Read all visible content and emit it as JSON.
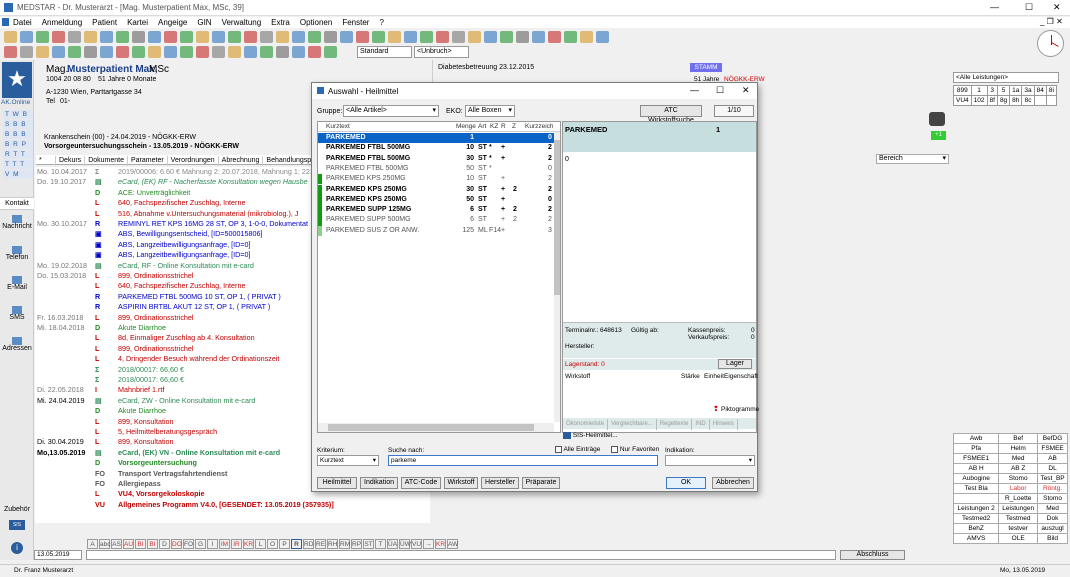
{
  "window": {
    "title": "MEDSTAR - Dr. Musterarzt - [Mag. Musterpatient Max, MSc, 39]",
    "min": "—",
    "max": "☐",
    "close": "✕"
  },
  "menu": [
    "Datei",
    "Anmeldung",
    "Patient",
    "Kartei",
    "Angeige",
    "GIN",
    "Verwaltung",
    "Extra",
    "Optionen",
    "Fenster",
    "?"
  ],
  "toolbar": {
    "standard": "Standard",
    "unbruch": "<Unbruch>"
  },
  "patient": {
    "title": "Mag.",
    "name": "Musterpatient Max,",
    "suffix": "MSc",
    "svnr": "1004 20 08 80",
    "age": "51 Jahre 0 Monate",
    "address": "A-1230 Wien, Parttartgasse 34",
    "tel_label": "Tel",
    "tel": "01-",
    "logo_text": "AK.Online",
    "info": "Diabetesbetreuung 23.12.2015",
    "stamm": "STAMM",
    "stamm_age": "51 Jahre",
    "stamm_ins": "NÖGKK-ERW"
  },
  "krankenschein": "Krankenschein (00) - 24.04.2019 - NÖGKK-ERW",
  "vorsorge": "Vorsorgeuntersuchungsschein - 13.05.2019 - NÖGKK-ERW",
  "tabs": [
    "*",
    "Dekurs",
    "Dokumente",
    "Parameter",
    "Verordnungen",
    "Abrechnung",
    "Behandlungsperioden"
  ],
  "bereich": "Bereich",
  "left_letters": [
    "T W B",
    "S B B",
    "B B B",
    "B R P",
    "R T T",
    "T T T",
    "V M"
  ],
  "side_nav": {
    "kontakt": "Kontakt",
    "nachricht": "Nachricht",
    "telefon": "Telefon",
    "email": "E-Mail",
    "sms": "SMS",
    "adressen": "Adressen",
    "zubehoer": "Zubehör",
    "sis": "SIS"
  },
  "records": [
    {
      "d": "Mo. 10.04.2017",
      "t": "Σ",
      "txt": "2019/00006: 6.60 € Mahnung 2: 20.07.2018, Mahnung 1: 22.0",
      "c": "#888"
    },
    {
      "d": "Do. 19.10.2017",
      "t": "▤",
      "txt": "eCard, (EK) RF - Nacherfasste Konsultation wegen Hausbe",
      "c": "#2e8b57",
      "i": true
    },
    {
      "d": "",
      "t": "D",
      "txt": "ACE: Unverträglichkeit",
      "c": "#228b22"
    },
    {
      "d": "",
      "t": "L",
      "txt": "640, Fachspezifischer Zuschlag, Interne",
      "c": "#c00000"
    },
    {
      "d": "",
      "t": "L",
      "txt": "516, Abnahme v.Untersuchungsmaterial (mikrobiolog.), J",
      "c": "#c00000"
    },
    {
      "d": "Mo. 30.10.2017",
      "t": "R",
      "txt": "REMINYL RET KPS 16MG 28 ST, OP 3, 1-0-0, Dokumentat",
      "c": "#0000cc"
    },
    {
      "d": "",
      "t": "▣",
      "txt": "ABS, Bewilligungsentscheid, [ID=500015806]",
      "c": "#0000cc"
    },
    {
      "d": "",
      "t": "▣",
      "txt": "ABS, Langzeitbewilligungsanfrage, [ID=0]",
      "c": "#0000cc"
    },
    {
      "d": "",
      "t": "▣",
      "txt": "ABS, Langzeitbewilligungsanfrage, [ID=0]",
      "c": "#0000cc"
    },
    {
      "d": "Mo. 19.02.2018",
      "t": "▤",
      "txt": "eCard, RF - Online Konsultation mit e-card",
      "c": "#2e8b57"
    },
    {
      "d": "Do. 15.03.2018",
      "t": "L",
      "txt": "899, Ordinationsstrichel",
      "c": "#c00000"
    },
    {
      "d": "",
      "t": "L",
      "txt": "640, Fachspezifischer Zuschlag, Interne",
      "c": "#c00000"
    },
    {
      "d": "",
      "t": "R",
      "txt": "PARKEMED FTBL 500MG 10 ST, OP 1, ( PRIVAT )",
      "c": "#0000cc"
    },
    {
      "d": "",
      "t": "R",
      "txt": "ASPIRIN BRTBL AKUT 12 ST, OP 1, ( PRIVAT )",
      "c": "#0000cc"
    },
    {
      "d": "Fr. 16.03.2018",
      "t": "L",
      "txt": "899, Ordinationsstrichel",
      "c": "#c00000"
    },
    {
      "d": "Mi. 18.04.2018",
      "t": "D",
      "txt": "Akute Diarrhoe",
      "c": "#228b22"
    },
    {
      "d": "",
      "t": "L",
      "txt": "8d, Einmaliger Zuschlag ab 4. Konsultation",
      "c": "#c00000"
    },
    {
      "d": "",
      "t": "L",
      "txt": "899, Ordinationsstrichel",
      "c": "#c00000"
    },
    {
      "d": "",
      "t": "L",
      "txt": "4, Dringender Besuch während der Ordinationszeit",
      "c": "#c00000"
    },
    {
      "d": "",
      "t": "Σ",
      "txt": "2018/00017: 66,60 €",
      "c": "#2e8b57"
    },
    {
      "d": "",
      "t": "Σ",
      "txt": "2018/00017: 66,60 €",
      "c": "#2e8b57"
    },
    {
      "d": "Di. 22.05.2018",
      "t": "I",
      "txt": "Mahnbrief 1.rtf",
      "c": "#c00000"
    },
    {
      "d": "Mi. 24.04.2019",
      "t": "▤",
      "txt": "eCard, ZW - Online Konsultation mit e-card",
      "c": "#2e8b57",
      "dd": "#000"
    },
    {
      "d": "",
      "t": "D",
      "txt": "Akute Diarrhoe",
      "c": "#228b22"
    },
    {
      "d": "",
      "t": "L",
      "txt": "899, Konsultation",
      "c": "#c00000"
    },
    {
      "d": "",
      "t": "L",
      "txt": "5, Heilmittelberatungsgespräch",
      "c": "#c00000"
    },
    {
      "d": "Di. 30.04.2019",
      "t": "L",
      "txt": "899, Konsultation",
      "c": "#c00000",
      "dd": "#000"
    },
    {
      "d": "Mo,13.05.2019",
      "t": "▤",
      "txt": "eCard, (EK) VN - Online Konsultation mit e-card",
      "c": "#2e8b57",
      "b": true,
      "dd": "#000"
    },
    {
      "d": "",
      "t": "D",
      "txt": "Vorsorgeuntersuchung",
      "c": "#228b22",
      "b": true
    },
    {
      "d": "",
      "t": "FO",
      "txt": "Transport Vertragsfahrtendienst",
      "c": "#555",
      "b": true
    },
    {
      "d": "",
      "t": "FO",
      "txt": "Allergiepass",
      "c": "#555",
      "b": true
    },
    {
      "d": "",
      "t": "L",
      "txt": "VU4, Vorsorgekoloskopie",
      "c": "#c00000",
      "b": true
    },
    {
      "d": "",
      "t": "VU",
      "txt": "Allgemeines Programm V4.0, [GESENDET: 13.05.2019 (357935)]",
      "c": "#c00000",
      "b": true
    }
  ],
  "dialog": {
    "title": "Auswahl - Heilmittel",
    "gruppe_label": "Gruppe:",
    "gruppe": "<Alle Artikel>",
    "eko_label": "EKO:",
    "eko": "Alle Boxen",
    "atc_btn": "ATC Wirkstoffsuche",
    "page": "1/10",
    "cols": {
      "kurztext": "Kurztext",
      "menge": "Menge",
      "art": "Art",
      "kz": "KZ",
      "r": "R",
      "z": "Z",
      "kurzzeich": "Kurzzeich"
    },
    "items": [
      {
        "n": "PARKEMED",
        "m": "1",
        "a": "",
        "k": "",
        "r": "",
        "z": "",
        "e": "0",
        "sel": true,
        "bold": true,
        "bar": "#0a63c7"
      },
      {
        "n": "PARKEMED FTBL 500MG",
        "m": "10",
        "a": "ST",
        "k": "*",
        "r": "+",
        "z": "",
        "e": "2",
        "bold": true,
        "bar": ""
      },
      {
        "n": "PARKEMED FTBL 500MG",
        "m": "30",
        "a": "ST",
        "k": "*",
        "r": "+",
        "z": "",
        "e": "2",
        "bold": true,
        "bar": ""
      },
      {
        "n": "PARKEMED FTBL 500MG",
        "m": "50",
        "a": "ST",
        "k": "*",
        "r": "",
        "z": "",
        "e": "0",
        "bold": false,
        "bar": ""
      },
      {
        "n": "PARKEMED KPS 250MG",
        "m": "10",
        "a": "ST",
        "k": "",
        "r": "+",
        "z": "",
        "e": "2",
        "bold": false,
        "bar": "#119c11"
      },
      {
        "n": "PARKEMED KPS 250MG",
        "m": "30",
        "a": "ST",
        "k": "",
        "r": "+",
        "z": "2",
        "e": "2",
        "bold": true,
        "bar": "#119c11"
      },
      {
        "n": "PARKEMED KPS 250MG",
        "m": "50",
        "a": "ST",
        "k": "",
        "r": "+",
        "z": "",
        "e": "0",
        "bold": true,
        "bar": "#119c11"
      },
      {
        "n": "PARKEMED SUPP 125MG",
        "m": "6",
        "a": "ST",
        "k": "",
        "r": "+",
        "z": "2",
        "e": "2",
        "bold": true,
        "bar": "#119c11"
      },
      {
        "n": "PARKEMED SUPP 500MG",
        "m": "6",
        "a": "ST",
        "k": "",
        "r": "+",
        "z": "2",
        "e": "2",
        "bold": false,
        "bar": "#119c11"
      },
      {
        "n": "PARKEMED SUS Z OR ANW.",
        "m": "125",
        "a": "ML",
        "k": "F14",
        "r": "+",
        "z": "",
        "e": "3",
        "bold": false,
        "bar": "#8ecf8e"
      }
    ],
    "detail_name": "PARKEMED",
    "detail_qty": "1",
    "detail_zero": "0",
    "terminalnr_label": "Terminalnr.:",
    "terminalnr": "648613",
    "gueltig": "Gültig ab:",
    "kassenpreis": "Kassenpreis:",
    "kassenpreis_v": "0",
    "verkaufspreis": "Verkaufspreis:",
    "verkaufspreis_v": "0",
    "hersteller": "Hersteller:",
    "lagerstand": "Lagerstand: 0",
    "lager_btn": "Lager",
    "wirkstoff": "Wirkstoff",
    "staerke": "Stärke",
    "einheit": "Einheit",
    "eigenschaft": "Eigenschaft",
    "piktogramme": "Piktogramme",
    "info_tabs": [
      "Ökonomieliste",
      "Vergleichbare...",
      "Regeltexte",
      "IND",
      "Hinweis"
    ],
    "sis": "SIS-Heilmittel...",
    "kriterium_label": "Kriterium:",
    "kriterium": "Kurztext",
    "suche_label": "Suche nach:",
    "suche": "parkeme",
    "alle_eintraege": "Alle Einträge",
    "nur_favoriten": "Nur Favoriten",
    "indikation": "Indikation:",
    "bottom_tabs": [
      "Heilmittel",
      "Indikation",
      "ATC-Code",
      "Wirkstoff",
      "Hersteller",
      "Präparate"
    ],
    "ok": "OK",
    "abbrechen": "Abbrechen"
  },
  "right": {
    "dropdown": "<Alle Leistungen>",
    "grid": [
      [
        "899",
        "1",
        "3",
        "5",
        "1a",
        "3a",
        "84",
        "8i"
      ],
      [
        "VU4",
        "102",
        "8f",
        "8g",
        "8h",
        "8c",
        "",
        ""
      ]
    ],
    "buttons": [
      [
        "Awb",
        "Bef",
        "BefDG"
      ],
      [
        "Pfa",
        "Helm",
        "FSMEE"
      ],
      [
        "FSMEE1",
        "Med",
        "AB"
      ],
      [
        "AB H",
        "AB Z",
        "DL"
      ],
      [
        "Aubogine",
        "Stomo",
        "Test_BP"
      ],
      [
        "Test Bla",
        "Labor",
        "Röntg."
      ],
      [
        "",
        "R_Loette",
        "Stomo"
      ],
      [
        "Leistungen 2",
        "Leistungen",
        "Med"
      ],
      [
        "Testmed2",
        "Testmed",
        "Dok"
      ],
      [
        "BehZ",
        "testver",
        "auszugl"
      ],
      [
        "AMVS",
        "OLE",
        "Bild"
      ]
    ]
  },
  "letters": [
    "A",
    "abc",
    "AS",
    "AU",
    "BI",
    "BI",
    "D",
    "DO",
    "FO",
    "G",
    "I",
    "IM",
    "IR",
    "KR",
    "L",
    "O",
    "P",
    "R",
    "RD",
    "RE",
    "RH",
    "RM",
    "RP",
    "ST",
    "T",
    "ÜA",
    "ÜW",
    "VU",
    "→",
    "KR",
    "AW"
  ],
  "bottom": {
    "date": "13.05.2019",
    "abschluss": "Abschluss",
    "user": "Dr. Franz Musterarzt",
    "statusdate": "Mo, 13.05.2019"
  }
}
